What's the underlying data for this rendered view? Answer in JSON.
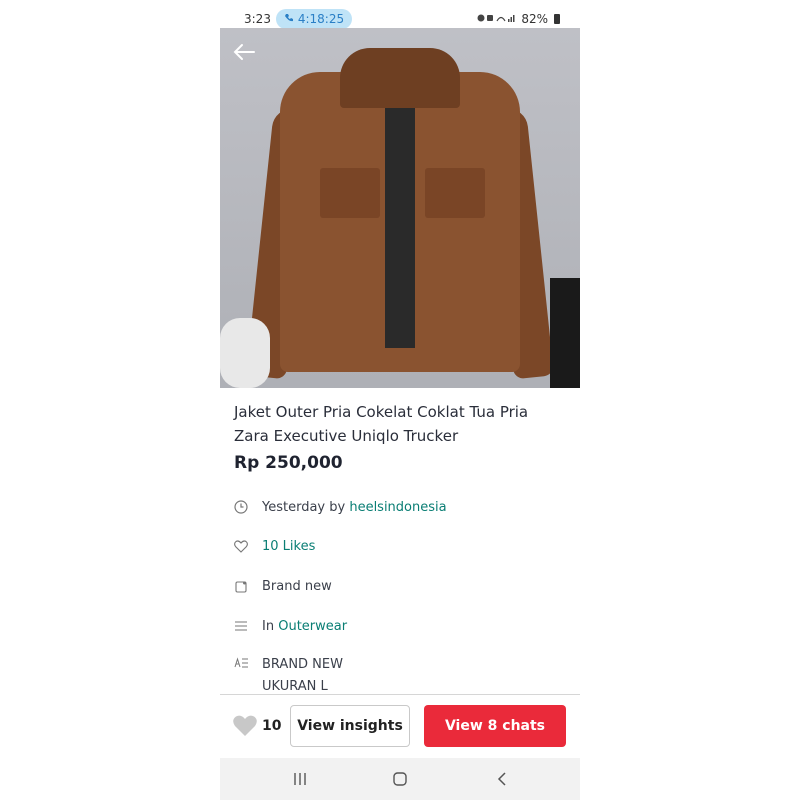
{
  "status_bar": {
    "time": "3:23",
    "call_timer": "4:18:25",
    "battery": "82%",
    "icons": [
      "call-icon",
      "wifi-icon",
      "signal-icon",
      "battery-icon"
    ]
  },
  "product": {
    "title": "Jaket Outer Pria Cokelat Coklat Tua Pria Zara Executive Uniqlo Trucker",
    "price": "Rp 250,000",
    "photo_icon": "jacket-photo"
  },
  "info": {
    "date_prefix": "Yesterday by ",
    "seller": "heelsindonesia",
    "likes": "10 Likes",
    "condition": "Brand new",
    "category_prefix": "In ",
    "category": "Outerwear",
    "description_lines": [
      "BRAND NEW",
      "UKURAN L"
    ]
  },
  "actions": {
    "like_count": "10",
    "insights_label": "View insights",
    "chats_label": "View 8 chats"
  },
  "colors": {
    "accent": "#ea2a3a",
    "link": "#0a7e74",
    "call_pill": "#bfe3f7"
  }
}
